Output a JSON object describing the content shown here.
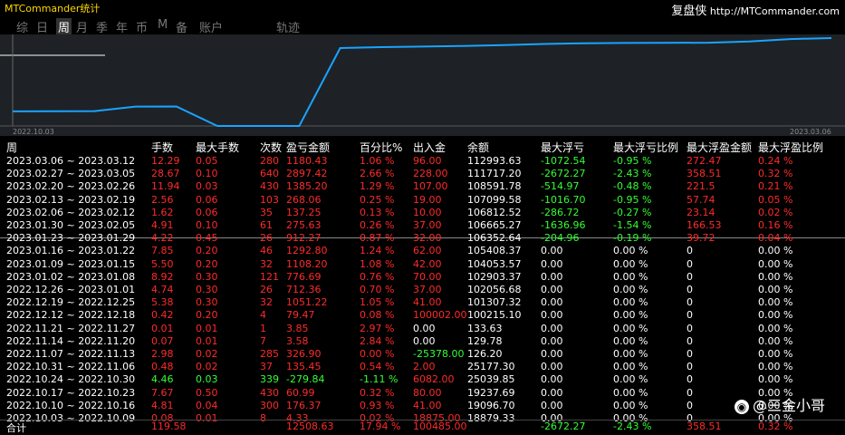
{
  "title": "MTCommander统计",
  "brand": {
    "name": "复盘侠",
    "url": "http://MTCommander.com"
  },
  "tabs": [
    "综",
    "日",
    "周",
    "月",
    "季",
    "年",
    "币",
    "M",
    "备",
    "账户",
    "轨迹"
  ],
  "active_tab": "周",
  "chart_data": {
    "type": "line",
    "x_start_label": "2022.10.03",
    "x_end_label": "2023.03.06",
    "y": [
      18879.33,
      19096.7,
      19237.69,
      25039.85,
      25177.3,
      126.2,
      129.78,
      133.63,
      100215.1,
      101307.32,
      102056.68,
      102903.37,
      104053.57,
      105408.37,
      106352.64,
      106665.27,
      106812.52,
      107099.58,
      108591.78,
      111717.2,
      112993.63
    ],
    "line_color": "#1aa3ff"
  },
  "columns": [
    "周",
    "手数",
    "最大手数",
    "次数",
    "盈亏金额",
    "百分比%",
    "出入金",
    "余额",
    "最大浮亏",
    "最大浮亏比例",
    "最大浮盈金额",
    "最大浮盈比例"
  ],
  "rows": [
    [
      "2023.03.06 ~ 2023.03.12",
      "12.29",
      "0.05",
      "280",
      "1180.43",
      "1.06 %",
      "96.00",
      "112993.63",
      "-1072.54",
      "-0.95 %",
      "272.47",
      "0.24 %"
    ],
    [
      "2023.02.27 ~ 2023.03.05",
      "28.67",
      "0.10",
      "640",
      "2897.42",
      "2.66 %",
      "228.00",
      "111717.20",
      "-2672.27",
      "-2.43 %",
      "358.51",
      "0.32 %"
    ],
    [
      "2023.02.20 ~ 2023.02.26",
      "11.94",
      "0.03",
      "430",
      "1385.20",
      "1.29 %",
      "107.00",
      "108591.78",
      "-514.97",
      "-0.48 %",
      "221.5",
      "0.21 %"
    ],
    [
      "2023.02.13 ~ 2023.02.19",
      "2.56",
      "0.06",
      "103",
      "268.06",
      "0.25 %",
      "19.00",
      "107099.58",
      "-1016.70",
      "-0.95 %",
      "57.74",
      "0.05 %"
    ],
    [
      "2023.02.06 ~ 2023.02.12",
      "1.62",
      "0.06",
      "35",
      "137.25",
      "0.13 %",
      "10.00",
      "106812.52",
      "-286.72",
      "-0.27 %",
      "23.14",
      "0.02 %"
    ],
    [
      "2023.01.30 ~ 2023.02.05",
      "4.91",
      "0.10",
      "61",
      "275.63",
      "0.26 %",
      "37.00",
      "106665.27",
      "-1636.96",
      "-1.54 %",
      "166.53",
      "0.16 %"
    ],
    [
      "2023.01.23 ~ 2023.01.29",
      "4.22",
      "0.45",
      "26",
      "912.27",
      "0.87 %",
      "32.00",
      "106352.64",
      "-204.96",
      "-0.19 %",
      "39.72",
      "0.04 %"
    ],
    [
      "2023.01.16 ~ 2023.01.22",
      "7.85",
      "0.20",
      "46",
      "1292.80",
      "1.24 %",
      "62.00",
      "105408.37",
      "0.00",
      "0.00 %",
      "0",
      "0.00 %"
    ],
    [
      "2023.01.09 ~ 2023.01.15",
      "5.50",
      "0.20",
      "32",
      "1108.20",
      "1.08 %",
      "42.00",
      "104053.57",
      "0.00",
      "0.00 %",
      "0",
      "0.00 %"
    ],
    [
      "2023.01.02 ~ 2023.01.08",
      "8.92",
      "0.30",
      "121",
      "776.69",
      "0.76 %",
      "70.00",
      "102903.37",
      "0.00",
      "0.00 %",
      "0",
      "0.00 %"
    ],
    [
      "2022.12.26 ~ 2023.01.01",
      "4.74",
      "0.30",
      "26",
      "712.36",
      "0.70 %",
      "37.00",
      "102056.68",
      "0.00",
      "0.00 %",
      "0",
      "0.00 %"
    ],
    [
      "2022.12.19 ~ 2022.12.25",
      "5.38",
      "0.30",
      "32",
      "1051.22",
      "1.05 %",
      "41.00",
      "101307.32",
      "0.00",
      "0.00 %",
      "0",
      "0.00 %"
    ],
    [
      "2022.12.12 ~ 2022.12.18",
      "0.42",
      "0.20",
      "4",
      "79.47",
      "0.08 %",
      "100002.00",
      "100215.10",
      "0.00",
      "0.00 %",
      "0",
      "0.00 %"
    ],
    [
      "2022.11.21 ~ 2022.11.27",
      "0.01",
      "0.01",
      "1",
      "3.85",
      "2.97 %",
      "0.00",
      "133.63",
      "0.00",
      "0.00 %",
      "0",
      "0.00 %"
    ],
    [
      "2022.11.14 ~ 2022.11.20",
      "0.07",
      "0.01",
      "7",
      "3.58",
      "2.84 %",
      "0.00",
      "129.78",
      "0.00",
      "0.00 %",
      "0",
      "0.00 %"
    ],
    [
      "2022.11.07 ~ 2022.11.13",
      "2.98",
      "0.02",
      "285",
      "326.90",
      "0.00 %",
      "-25378.00",
      "126.20",
      "0.00",
      "0.00 %",
      "0",
      "0.00 %"
    ],
    [
      "2022.10.31 ~ 2022.11.06",
      "0.48",
      "0.02",
      "37",
      "135.45",
      "0.54 %",
      "2.00",
      "25177.30",
      "0.00",
      "0.00 %",
      "0",
      "0.00 %"
    ],
    [
      "2022.10.24 ~ 2022.10.30",
      "4.46",
      "0.03",
      "339",
      "-279.84",
      "-1.11 %",
      "6082.00",
      "25039.85",
      "0.00",
      "0.00 %",
      "0",
      "0.00 %"
    ],
    [
      "2022.10.17 ~ 2022.10.23",
      "7.67",
      "0.50",
      "430",
      "60.99",
      "0.32 %",
      "80.00",
      "19237.69",
      "0.00",
      "0.00 %",
      "0",
      "0.00 %"
    ],
    [
      "2022.10.10 ~ 2022.10.16",
      "4.81",
      "0.04",
      "300",
      "176.37",
      "0.93 %",
      "41.00",
      "19096.70",
      "0.00",
      "0.00 %",
      "0",
      "0.00 %"
    ],
    [
      "2022.10.03 ~ 2022.10.09",
      "0.08",
      "0.01",
      "8",
      "4.33",
      "0.02 %",
      "18875.00",
      "18879.33",
      "0.00",
      "0.00 %",
      "0",
      "0.00 %"
    ]
  ],
  "total": [
    "合计",
    "119.58",
    "",
    "",
    "12508.63",
    "17.94 %",
    "100485.00",
    "",
    "-2672.27",
    "-2.43 %",
    "358.51",
    "0.32 %"
  ],
  "watermark": "@三金小哥",
  "colors": {
    "positive": "#ff2a2a",
    "negative": "#33ff33",
    "neutral": "#ffffff"
  }
}
